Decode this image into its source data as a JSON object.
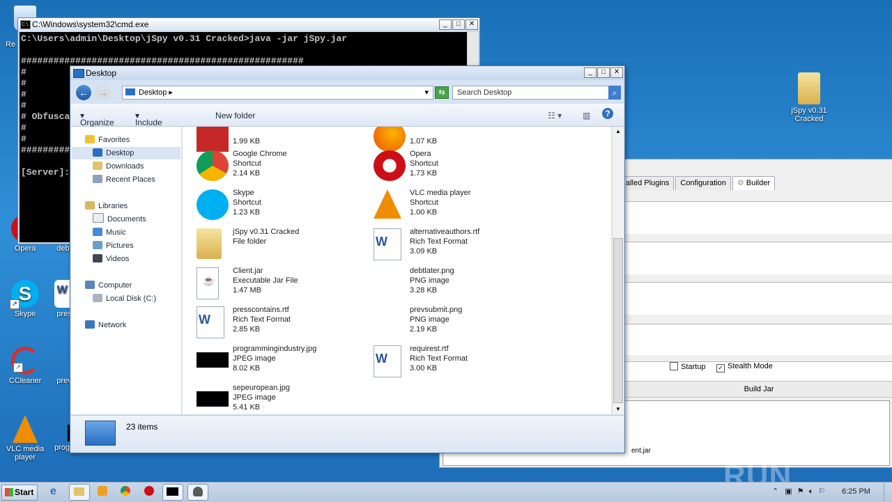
{
  "desktop_icons": [
    {
      "label": "Re",
      "color": "#d6e9ff"
    },
    {
      "label": "Opera",
      "color": "#cc0f16"
    },
    {
      "label": "debt",
      "color": "#ffffff"
    },
    {
      "label": "Skype",
      "color": "#00aff0"
    },
    {
      "label": "pres",
      "color": "#2b5797"
    },
    {
      "label": "CCleaner",
      "color": "#c0392b"
    },
    {
      "label": "prev",
      "color": "#ffffff"
    },
    {
      "label": "VLC media player",
      "color": "#f08c00"
    },
    {
      "label": "programmin...",
      "color": "#000000"
    },
    {
      "label": "jSpy v0.31 Cracked",
      "color": "#e8c86a"
    }
  ],
  "cmd": {
    "title": "C:\\Windows\\system32\\cmd.exe",
    "icon_text": "C:\\.",
    "lines": [
      "C:\\Users\\admin\\Desktop\\jSpy v0.31 Cracked>java -jar jSpy.jar",
      "",
      "####################################################",
      "#",
      "#",
      "#",
      "#",
      "# Obfusca",
      "#",
      "#",
      "####################################################",
      "",
      "[Server]:"
    ]
  },
  "builder": {
    "tabs": [
      "alled Plugins",
      "Configuration",
      "Builder"
    ],
    "startup_label": "Startup",
    "stealth_label": "Stealth Mode",
    "stealth_checked": "✓",
    "build_button": "Build Jar",
    "output_text": "ent.jar"
  },
  "explorer": {
    "title": "Desktop",
    "address": "Desktop",
    "search_placeholder": "Search Desktop",
    "toolbar": {
      "organize": "Organize",
      "include": "Include in library",
      "newfolder": "New folder"
    },
    "nav": {
      "favorites": "Favorites",
      "desktop": "Desktop",
      "downloads": "Downloads",
      "recent": "Recent Places",
      "libraries": "Libraries",
      "documents": "Documents",
      "music": "Music",
      "pictures": "Pictures",
      "videos": "Videos",
      "computer": "Computer",
      "localdisk": "Local Disk (C:)",
      "network": "Network"
    },
    "files": [
      {
        "name": "",
        "type": "",
        "size": "1.99 KB",
        "icon": "red-app"
      },
      {
        "name": "",
        "type": "",
        "size": "1.07 KB",
        "icon": "firefox"
      },
      {
        "name": "Google Chrome",
        "type": "Shortcut",
        "size": "2.14 KB",
        "icon": "chrome"
      },
      {
        "name": "Opera",
        "type": "Shortcut",
        "size": "1.73 KB",
        "icon": "opera"
      },
      {
        "name": "Skype",
        "type": "Shortcut",
        "size": "1.23 KB",
        "icon": "skype"
      },
      {
        "name": "VLC media player",
        "type": "Shortcut",
        "size": "1.00 KB",
        "icon": "vlc"
      },
      {
        "name": "jSpy v0.31 Cracked",
        "type": "File folder",
        "size": "",
        "icon": "folder"
      },
      {
        "name": "alternativeauthors.rtf",
        "type": "Rich Text Format",
        "size": "3.09 KB",
        "icon": "word"
      },
      {
        "name": "Client.jar",
        "type": "Executable Jar File",
        "size": "1.47 MB",
        "icon": "jar"
      },
      {
        "name": "debtlater.png",
        "type": "PNG image",
        "size": "3.28 KB",
        "icon": "png"
      },
      {
        "name": "presscontains.rtf",
        "type": "Rich Text Format",
        "size": "2.85 KB",
        "icon": "word"
      },
      {
        "name": "prevsubmit.png",
        "type": "PNG image",
        "size": "2.19 KB",
        "icon": "png"
      },
      {
        "name": "programmingindustry.jpg",
        "type": "JPEG image",
        "size": "8.02 KB",
        "icon": "jpg"
      },
      {
        "name": "requirest.rtf",
        "type": "Rich Text Format",
        "size": "3.00 KB",
        "icon": "word"
      },
      {
        "name": "sepeuropean.jpg",
        "type": "JPEG image",
        "size": "5.41 KB",
        "icon": "jpg"
      }
    ],
    "status": "23 items"
  },
  "taskbar": {
    "start": "Start",
    "time": "6:25 PM"
  },
  "watermark": "ANY ▷ RUN"
}
